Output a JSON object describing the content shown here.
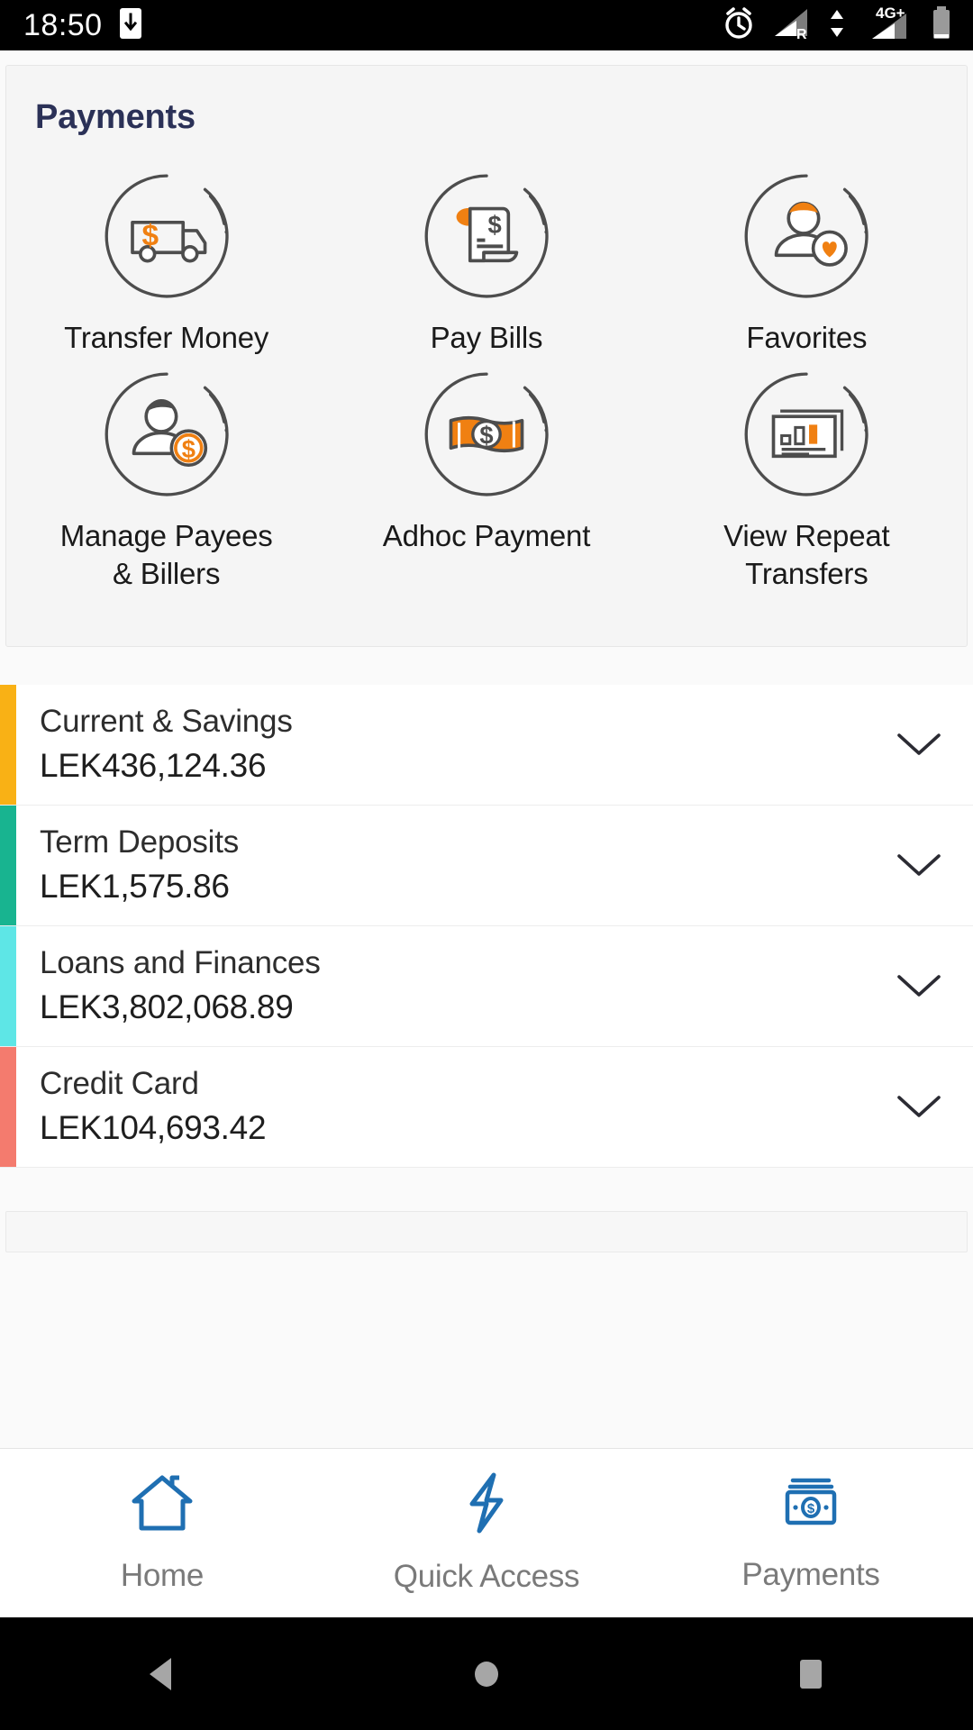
{
  "status_bar": {
    "time": "18:50",
    "network_label": "4G+",
    "roaming_label": "R",
    "icons": [
      "download-to-phone-icon",
      "alarm-clock-icon",
      "signal-roaming-icon",
      "data-transfer-icon",
      "signal-4g-icon",
      "battery-icon"
    ]
  },
  "payments_card": {
    "title": "Payments",
    "tiles": [
      {
        "label": "Transfer Money",
        "icon": "money-van-icon"
      },
      {
        "label": "Pay Bills",
        "icon": "bill-receipt-icon"
      },
      {
        "label": "Favorites",
        "icon": "person-heart-icon"
      },
      {
        "label": "Manage Payees\n& Billers",
        "icon": "person-coin-icon"
      },
      {
        "label": "Adhoc Payment",
        "icon": "banknote-icon"
      },
      {
        "label": "View Repeat\nTransfers",
        "icon": "chart-card-icon"
      }
    ]
  },
  "accounts": [
    {
      "name": "Current & Savings",
      "amount": "LEK436,124.36",
      "color": "#f9b115",
      "chevron": "chevron-down-icon"
    },
    {
      "name": "Term Deposits",
      "amount": "LEK1,575.86",
      "color": "#18b490",
      "chevron": "chevron-down-icon"
    },
    {
      "name": "Loans and Finances",
      "amount": "LEK3,802,068.89",
      "color": "#5ee6e6",
      "chevron": "chevron-down-icon"
    },
    {
      "name": "Credit Card",
      "amount": "LEK104,693.42",
      "color": "#f47b6e",
      "chevron": "chevron-down-icon"
    }
  ],
  "bottom_nav": {
    "items": [
      {
        "label": "Home",
        "icon": "home-icon"
      },
      {
        "label": "Quick Access",
        "icon": "lightning-bolt-icon"
      },
      {
        "label": "Payments",
        "icon": "money-stack-icon"
      }
    ]
  },
  "android_nav": {
    "back": "back-triangle-icon",
    "home": "home-circle-icon",
    "recents": "recents-square-icon"
  },
  "colors": {
    "accent_orange": "#f08012",
    "icon_stroke": "#4d4d4d",
    "title_navy": "#2b3157",
    "nav_blue": "#1f6fb2",
    "card_bg": "#f5f5f5",
    "page_bg": "#fafafa"
  }
}
